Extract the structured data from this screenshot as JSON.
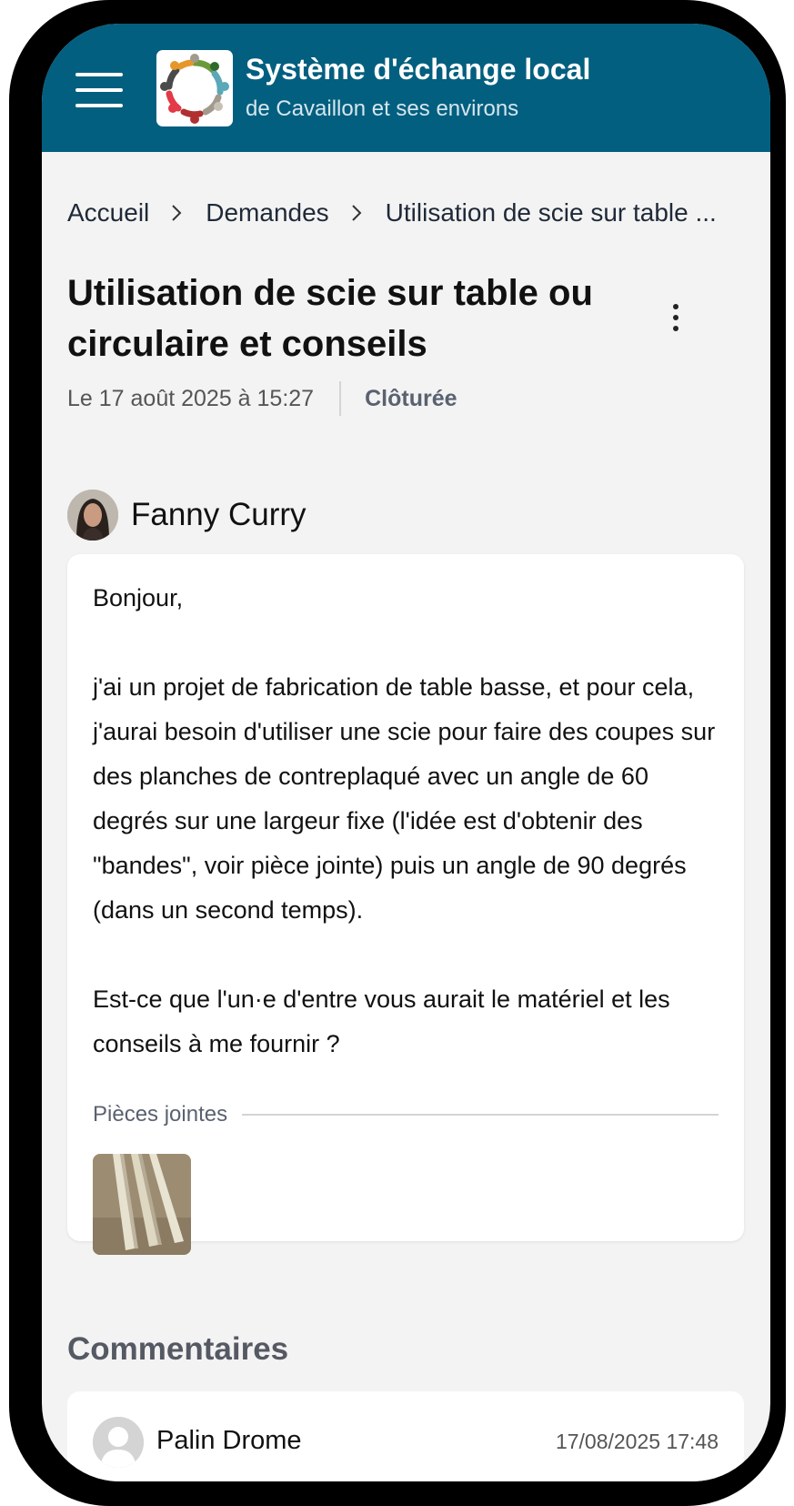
{
  "header": {
    "title": "Système d'échange local",
    "subtitle": "de Cavaillon et ses environs",
    "menu_icon": "hamburger-menu-icon",
    "logo_icon": "community-circle-logo",
    "background_color": "#035f7f"
  },
  "breadcrumb": {
    "items": [
      "Accueil",
      "Demandes"
    ],
    "current": "Utilisation de scie sur table ...",
    "separator_icon": "chevron-right-icon"
  },
  "request": {
    "title": "Utilisation de scie sur table ou circulaire et conseils",
    "date": "Le 17 août 2025 à 15:27",
    "status": "Clôturée",
    "more_icon": "more-vertical-icon"
  },
  "author": {
    "name": "Fanny Curry"
  },
  "body": {
    "paragraphs": [
      "Bonjour,",
      "j'ai un projet de fabrication de table basse, et pour cela, j'aurai besoin d'utiliser une scie pour faire des coupes sur des planches de contreplaqué avec un angle de 60 degrés sur une largeur fixe (l'idée est d'obtenir des \"bandes\", voir pièce jointe) puis un angle de 90 degrés (dans un second temps).",
      "Est-ce que l'un·e d'entre vous aurait le matériel et les conseils à me fournir ?"
    ]
  },
  "attachments": {
    "label": "Pièces jointes"
  },
  "comments": {
    "title": "Commentaires",
    "items": [
      {
        "author": "Palin Drome",
        "date": "17/08/2025 17:48"
      }
    ]
  }
}
